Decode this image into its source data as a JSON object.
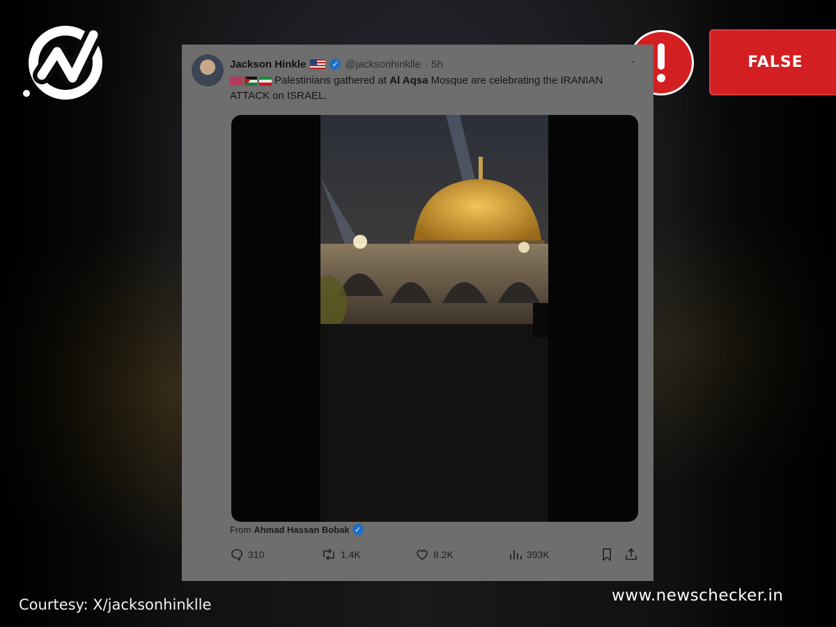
{
  "overlay": {
    "verdict_label": "FALSE",
    "verdict_color": "#d41f22",
    "logo_icon": "newschecker-check-logo-icon",
    "alert_icon": "exclamation-icon",
    "courtesy": "Courtesy: X/jacksonhinklle",
    "site": "www.newschecker.in"
  },
  "tweet": {
    "author": "Jackson Hinkle",
    "handle": "@jacksonhinklle",
    "time": "· 5h",
    "more_icon": "more-dots-icon",
    "text_before": "Palestinians gathered at ",
    "text_highlight": "Al Aqsa",
    "text_after": " Mosque are celebrating the IRANIAN ATTACK on ISRAEL.",
    "from_prefix": "From",
    "from_name": "Ahmad Hassan Bobak",
    "stats": {
      "replies": "310",
      "retweets": "1.4K",
      "likes": "8.2K",
      "views": "393K"
    }
  }
}
